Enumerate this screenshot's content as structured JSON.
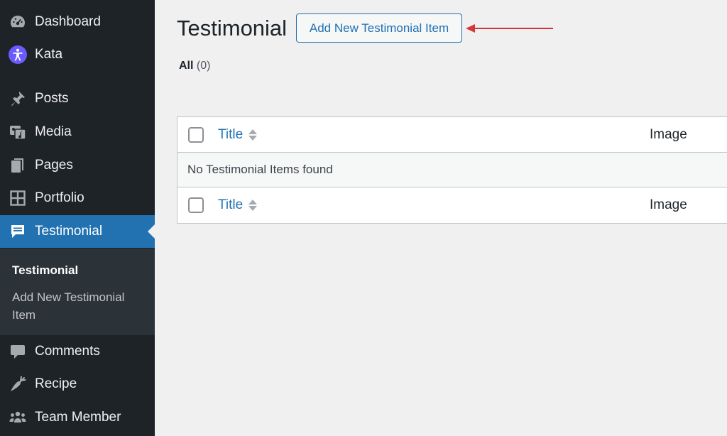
{
  "sidebar": {
    "items": [
      {
        "label": "Dashboard",
        "icon": "dashboard-icon"
      },
      {
        "label": "Kata",
        "icon": "accessibility-icon"
      },
      {
        "label": "Posts",
        "icon": "pin-icon"
      },
      {
        "label": "Media",
        "icon": "media-icon"
      },
      {
        "label": "Pages",
        "icon": "pages-icon"
      },
      {
        "label": "Portfolio",
        "icon": "grid-icon"
      },
      {
        "label": "Testimonial",
        "icon": "testimonial-icon"
      },
      {
        "label": "Comments",
        "icon": "comment-icon"
      },
      {
        "label": "Recipe",
        "icon": "carrot-icon"
      },
      {
        "label": "Team Member",
        "icon": "group-icon"
      }
    ],
    "submenu": {
      "current": "Testimonial",
      "add_new": "Add New Testimonial Item"
    }
  },
  "main": {
    "title": "Testimonial",
    "add_new_button": "Add New Testimonial Item",
    "filter": {
      "label": "All",
      "count": "(0)"
    },
    "table": {
      "columns": {
        "title": "Title",
        "image": "Image"
      },
      "empty_message": "No Testimonial Items found"
    }
  },
  "colors": {
    "sidebar_bg": "#1d2327",
    "submenu_bg": "#2c3338",
    "accent": "#2271b1",
    "page_bg": "#f0f0f1",
    "annotation_arrow": "#d63638"
  }
}
